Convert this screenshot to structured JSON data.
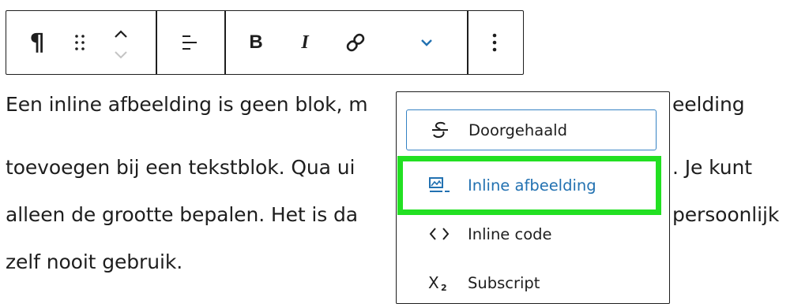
{
  "toolbar": {
    "paragraph_label": "¶",
    "bold_label": "B",
    "italic_label": "I"
  },
  "paragraph": {
    "lines": [
      "Een inline afbeelding is geen blok, m",
      "eelding",
      "toevoegen bij een tekstblok. Qua ui",
      ". Je kunt",
      "alleen de grootte bepalen. Het is da",
      "persoonlijk",
      "zelf nooit gebruik."
    ]
  },
  "format_menu": {
    "items": [
      {
        "label": "Doorgehaald",
        "icon": "strikethrough-icon"
      },
      {
        "label": "Inline afbeelding",
        "icon": "inline-image-icon"
      },
      {
        "label": "Inline code",
        "icon": "code-icon"
      },
      {
        "label": "Subscript",
        "icon": "subscript-icon"
      }
    ]
  },
  "colors": {
    "accent": "#2271b1",
    "highlight": "#22e022",
    "text": "#1e1e1e"
  }
}
